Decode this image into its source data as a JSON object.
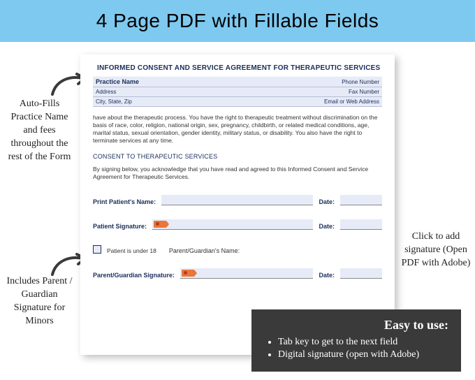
{
  "banner": {
    "title": "4 Page PDF with Fillable Fields"
  },
  "annotations": {
    "left1": "Auto-Fills Practice Name and fees throughout the rest of the Form",
    "left2": "Includes Parent / Guardian Signature for Minors",
    "right": "Click to add signature (Open PDF with Adobe)"
  },
  "doc": {
    "heading": "INFORMED CONSENT AND SERVICE AGREEMENT FOR THERAPEUTIC SERVICES",
    "header": {
      "practice": "Practice Name",
      "address": "Address",
      "city": "City, State, Zip",
      "phone": "Phone Number",
      "fax": "Fax Number",
      "email": "Email or Web Address"
    },
    "body_paragraph": "have about the therapeutic process. You have the right to therapeutic treatment without discrimination on the basis of race, color, religion, national origin, sex, pregnancy, childbirth, or related medical conditions, age, marital status, sexual orientation, gender identity, military status, or disability. You also have the right to terminate services at any time.",
    "consent_heading": "CONSENT TO THERAPEUTIC SERVICES",
    "consent_text": "By signing below, you acknowledge that you have read and agreed to this Informed Consent and Service Agreement for Therapeutic Services.",
    "labels": {
      "print_name": "Print Patient's Name:",
      "date": "Date:",
      "patient_sig": "Patient Signature:",
      "under18": "Patient is under 18",
      "guardian_name": "Parent/Guardian's Name:",
      "guardian_sig": "Parent/Guardian Signature:"
    }
  },
  "easy": {
    "title": "Easy to use:",
    "items": [
      "Tab key to get to the next field",
      "Digital signature (open with Adobe)"
    ]
  }
}
